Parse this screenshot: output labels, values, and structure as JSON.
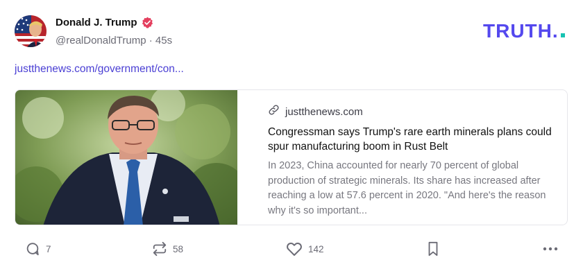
{
  "post": {
    "author_name": "Donald J. Trump",
    "handle": "@realDonaldTrump",
    "separator": "·",
    "time_ago": "45s",
    "link_text": "justthenews.com/government/con..."
  },
  "brand": {
    "logo_text": "TRUTH.",
    "logo_color": "#5448ee",
    "dot_color": "#17c3b2"
  },
  "card": {
    "domain": "justthenews.com",
    "title": "Congressman says Trump's rare earth minerals plans could spur manufacturing boom in Rust Belt",
    "description": "In 2023, China accounted for nearly 70 percent of global production of strategic minerals. Its share has increased after reaching a low at 57.6 percent in 2020. \"And here's the reason why it's so important..."
  },
  "actions": {
    "replies_count": "7",
    "retruths_count": "58",
    "likes_count": "142"
  },
  "colors": {
    "link": "#4a3fd4",
    "verified_badge": "#e4405f",
    "icon_gray": "#6b6b75"
  }
}
